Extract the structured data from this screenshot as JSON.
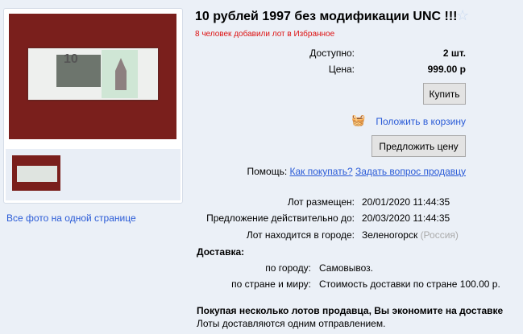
{
  "gallery": {
    "all_photos_link": "Все фото на одной странице"
  },
  "lot": {
    "title": "10 рублей 1997 без модификации UNC !!!",
    "favorites_note": "8 человек добавили лот в Избранное",
    "available_label": "Доступно:",
    "available_value": "2 шт.",
    "price_label": "Цена:",
    "price_value": "999.00 р",
    "buy_button": "Купить",
    "add_to_cart": "Положить в корзину",
    "offer_price_button": "Предложить цену",
    "help_label": "Помощь:",
    "help_how_to_buy": "Как покупать?",
    "help_ask_seller": "Задать вопрос продавцу",
    "posted_label": "Лот размещен:",
    "posted_value": "20/01/2020 11:44:35",
    "valid_label": "Предложение действительно до:",
    "valid_value": "20/03/2020 11:44:35",
    "city_label": "Лот находится в городе:",
    "city_value": "Зеленогорск",
    "country_value": "(Россия)",
    "delivery_heading": "Доставка:",
    "delivery_city_label": "по городу:",
    "delivery_city_value": "Самовывоз.",
    "delivery_world_label": "по стране и миру:",
    "delivery_world_value": "Стоимость доставки по стране 100.00 р.",
    "savings_bold": "Покупая несколько лотов продавца, Вы экономите на доставке",
    "savings_note": "Лоты доставляются одним отправлением."
  }
}
